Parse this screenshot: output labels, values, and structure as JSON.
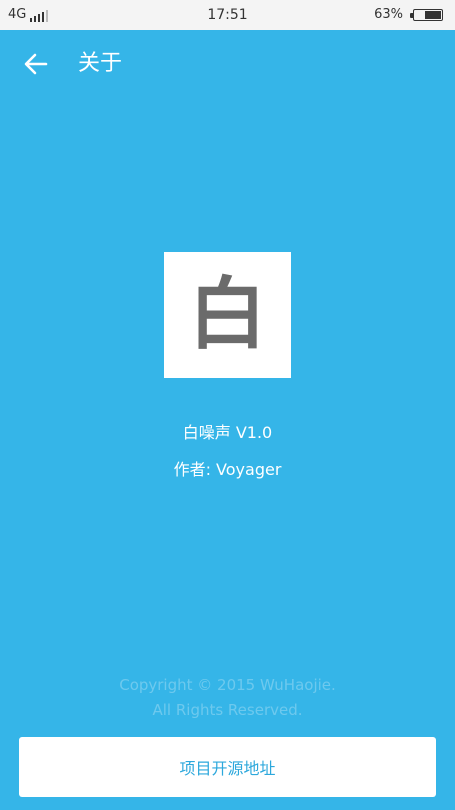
{
  "status_bar": {
    "network": "4G",
    "time": "17:51",
    "battery": "63%",
    "battery_level": 0.63
  },
  "app_bar": {
    "title": "关于",
    "back_icon": "arrow-left-icon"
  },
  "about": {
    "logo_glyph": "白",
    "app_name": "白噪声  V1.0",
    "author": "作者: Voyager"
  },
  "footer": {
    "copyright_line1": "Copyright © 2015 WuHaojie.",
    "copyright_line2": "All Rights Reserved."
  },
  "repo_button": {
    "label": "项目开源地址"
  },
  "colors": {
    "background": "#35B5E8",
    "button_text": "#2DA8DC",
    "logo_glyph": "#6B6B6B"
  }
}
